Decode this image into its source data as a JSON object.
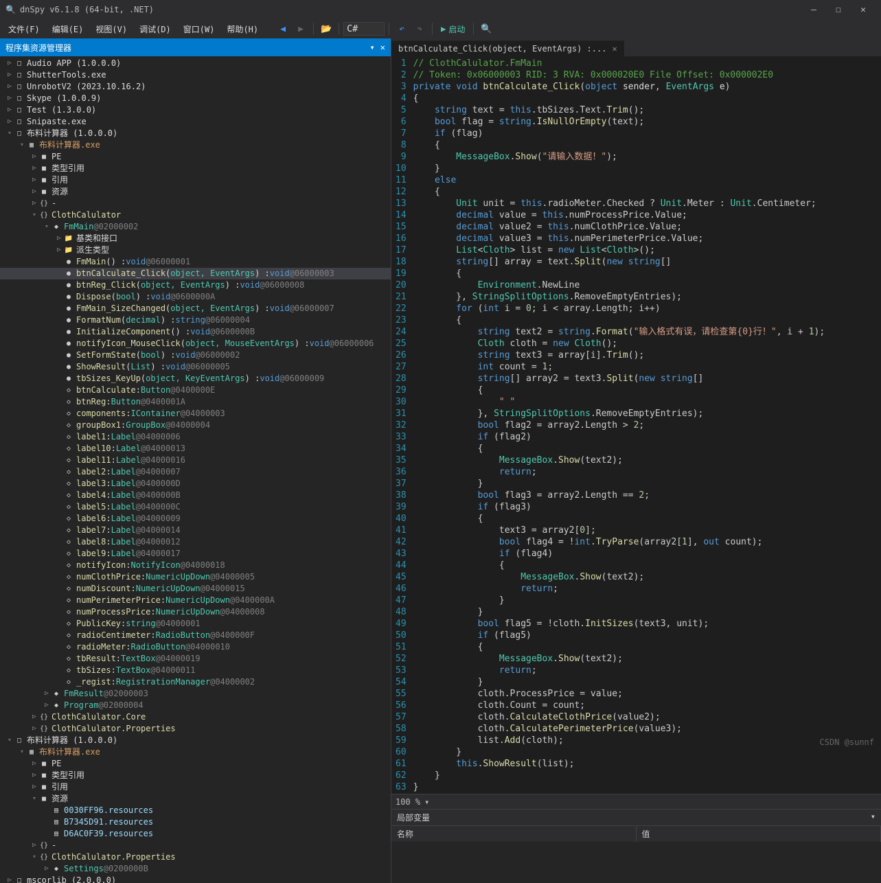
{
  "title": "dnSpy v6.1.8 (64-bit, .NET)",
  "menu": {
    "file": "文件(F)",
    "edit": "编辑(E)",
    "view": "视图(V)",
    "debug": "调试(D)",
    "window": "窗口(W)",
    "help": "帮助(H)",
    "lang": "C#",
    "start": "启动"
  },
  "panel": {
    "header": "程序集资源管理器"
  },
  "tree": [
    {
      "d": 0,
      "c": "▷",
      "i": "□",
      "t": "Audio APP (1.0.0.0)",
      "cls": "white"
    },
    {
      "d": 0,
      "c": "▷",
      "i": "□",
      "t": "ShutterTools.exe",
      "cls": "white"
    },
    {
      "d": 0,
      "c": "▷",
      "i": "□",
      "t": "UnrobotV2 (2023.10.16.2)",
      "cls": "white"
    },
    {
      "d": 0,
      "c": "▷",
      "i": "□",
      "t": "Skype (1.0.0.9)",
      "cls": "white"
    },
    {
      "d": 0,
      "c": "▷",
      "i": "□",
      "t": "Test (1.3.0.0)",
      "cls": "white"
    },
    {
      "d": 0,
      "c": "▷",
      "i": "□",
      "t": "Snipaste.exe",
      "cls": "white"
    },
    {
      "d": 0,
      "c": "▿",
      "i": "□",
      "t": "布料计算器 (1.0.0.0)",
      "cls": "white"
    },
    {
      "d": 1,
      "c": "▿",
      "i": "▦",
      "t": "布料计算器.exe",
      "cls": "oran"
    },
    {
      "d": 2,
      "c": "▷",
      "i": "■",
      "t": "PE",
      "cls": "white"
    },
    {
      "d": 2,
      "c": "▷",
      "i": "■",
      "t": "类型引用",
      "cls": "white"
    },
    {
      "d": 2,
      "c": "▷",
      "i": "■",
      "t": "引用",
      "cls": "white"
    },
    {
      "d": 2,
      "c": "▷",
      "i": "■",
      "t": "资源",
      "cls": "white"
    },
    {
      "d": 2,
      "c": "▷",
      "i": "{}",
      "t": "-",
      "cls": "white"
    },
    {
      "d": 2,
      "c": "▿",
      "i": "{}",
      "t": "ClothCalulator",
      "cls": "nm"
    },
    {
      "d": 3,
      "c": "▿",
      "i": "◆",
      "ty": "FmMain",
      "a": " @02000002"
    },
    {
      "d": 4,
      "c": "▷",
      "i": "📁",
      "t": "基类和接口",
      "cls": "white"
    },
    {
      "d": 4,
      "c": "▷",
      "i": "📁",
      "t": "派生类型",
      "cls": "white"
    },
    {
      "d": 4,
      "c": "",
      "i": "●",
      "sig": "FmMain() : void",
      "a": " @06000001"
    },
    {
      "d": 4,
      "c": "",
      "i": "●",
      "sig": "btnCalculate_Click(object, EventArgs) : void",
      "a": " @06000003",
      "sel": true
    },
    {
      "d": 4,
      "c": "",
      "i": "●",
      "sig": "btnReg_Click(object, EventArgs) : void",
      "a": " @06000008"
    },
    {
      "d": 4,
      "c": "",
      "i": "●",
      "sig": "Dispose(bool) : void",
      "a": " @0600000A"
    },
    {
      "d": 4,
      "c": "",
      "i": "●",
      "sig": "FmMain_SizeChanged(object, EventArgs) : void",
      "a": " @06000007"
    },
    {
      "d": 4,
      "c": "",
      "i": "●",
      "sig": "FormatNum(decimal) : string",
      "a": " @06000004"
    },
    {
      "d": 4,
      "c": "",
      "i": "●",
      "sig": "InitializeComponent() : void",
      "a": " @0600000B"
    },
    {
      "d": 4,
      "c": "",
      "i": "●",
      "sig": "notifyIcon_MouseClick(object, MouseEventArgs) : void",
      "a": " @06000006"
    },
    {
      "d": 4,
      "c": "",
      "i": "●",
      "sig": "SetFormState(bool) : void",
      "a": " @06000002"
    },
    {
      "d": 4,
      "c": "",
      "i": "●",
      "sig": "ShowResult(List<Cloth>) : void",
      "a": " @06000005"
    },
    {
      "d": 4,
      "c": "",
      "i": "●",
      "sig": "tbSizes_KeyUp(object, KeyEventArgs) : void",
      "a": " @06000009"
    },
    {
      "d": 4,
      "c": "",
      "i": "◇",
      "fld": "btnCalculate : Button",
      "a": " @0400000E"
    },
    {
      "d": 4,
      "c": "",
      "i": "◇",
      "fld": "btnReg : Button",
      "a": " @0400001A"
    },
    {
      "d": 4,
      "c": "",
      "i": "◇",
      "fld": "components : IContainer",
      "a": " @04000003"
    },
    {
      "d": 4,
      "c": "",
      "i": "◇",
      "fld": "groupBox1 : GroupBox",
      "a": " @04000004"
    },
    {
      "d": 4,
      "c": "",
      "i": "◇",
      "fld": "label1 : Label",
      "a": " @04000006"
    },
    {
      "d": 4,
      "c": "",
      "i": "◇",
      "fld": "label10 : Label",
      "a": " @04000013"
    },
    {
      "d": 4,
      "c": "",
      "i": "◇",
      "fld": "label11 : Label",
      "a": " @04000016"
    },
    {
      "d": 4,
      "c": "",
      "i": "◇",
      "fld": "label2 : Label",
      "a": " @04000007"
    },
    {
      "d": 4,
      "c": "",
      "i": "◇",
      "fld": "label3 : Label",
      "a": " @0400000D"
    },
    {
      "d": 4,
      "c": "",
      "i": "◇",
      "fld": "label4 : Label",
      "a": " @0400000B"
    },
    {
      "d": 4,
      "c": "",
      "i": "◇",
      "fld": "label5 : Label",
      "a": " @0400000C"
    },
    {
      "d": 4,
      "c": "",
      "i": "◇",
      "fld": "label6 : Label",
      "a": " @04000009"
    },
    {
      "d": 4,
      "c": "",
      "i": "◇",
      "fld": "label7 : Label",
      "a": " @04000014"
    },
    {
      "d": 4,
      "c": "",
      "i": "◇",
      "fld": "label8 : Label",
      "a": " @04000012"
    },
    {
      "d": 4,
      "c": "",
      "i": "◇",
      "fld": "label9 : Label",
      "a": " @04000017"
    },
    {
      "d": 4,
      "c": "",
      "i": "◇",
      "fld": "notifyIcon : NotifyIcon",
      "a": " @04000018"
    },
    {
      "d": 4,
      "c": "",
      "i": "◇",
      "fld": "numClothPrice : NumericUpDown",
      "a": " @04000005"
    },
    {
      "d": 4,
      "c": "",
      "i": "◇",
      "fld": "numDiscount : NumericUpDown",
      "a": " @04000015"
    },
    {
      "d": 4,
      "c": "",
      "i": "◇",
      "fld": "numPerimeterPrice : NumericUpDown",
      "a": " @0400000A"
    },
    {
      "d": 4,
      "c": "",
      "i": "◇",
      "fld": "numProcessPrice : NumericUpDown",
      "a": " @04000008"
    },
    {
      "d": 4,
      "c": "",
      "i": "◇",
      "fld": "PublicKey : string",
      "a": " @04000001"
    },
    {
      "d": 4,
      "c": "",
      "i": "◇",
      "fld": "radioCentimeter : RadioButton",
      "a": " @0400000F"
    },
    {
      "d": 4,
      "c": "",
      "i": "◇",
      "fld": "radioMeter : RadioButton",
      "a": " @04000010"
    },
    {
      "d": 4,
      "c": "",
      "i": "◇",
      "fld": "tbResult : TextBox",
      "a": " @04000019"
    },
    {
      "d": 4,
      "c": "",
      "i": "◇",
      "fld": "tbSizes : TextBox",
      "a": " @04000011"
    },
    {
      "d": 4,
      "c": "",
      "i": "◇",
      "fld": "_regist : RegistrationManager",
      "a": " @04000002"
    },
    {
      "d": 3,
      "c": "▷",
      "i": "◆",
      "ty": "FmResult",
      "a": " @02000003"
    },
    {
      "d": 3,
      "c": "▷",
      "i": "◆",
      "ty": "Program",
      "a": " @02000004"
    },
    {
      "d": 2,
      "c": "▷",
      "i": "{}",
      "t": "ClothCalulator.Core",
      "cls": "nm"
    },
    {
      "d": 2,
      "c": "▷",
      "i": "{}",
      "t": "ClothCalulator.Properties",
      "cls": "nm"
    },
    {
      "d": 0,
      "c": "▿",
      "i": "□",
      "t": "布料计算器 (1.0.0.0)",
      "cls": "white"
    },
    {
      "d": 1,
      "c": "▿",
      "i": "▦",
      "t": "布料计算器.exe",
      "cls": "oran"
    },
    {
      "d": 2,
      "c": "▷",
      "i": "■",
      "t": "PE",
      "cls": "white"
    },
    {
      "d": 2,
      "c": "▷",
      "i": "■",
      "t": "类型引用",
      "cls": "white"
    },
    {
      "d": 2,
      "c": "▷",
      "i": "■",
      "t": "引用",
      "cls": "white"
    },
    {
      "d": 2,
      "c": "▿",
      "i": "■",
      "t": "资源",
      "cls": "white"
    },
    {
      "d": 3,
      "c": "",
      "i": "▤",
      "t": "0030FF96.resources",
      "cls": "cyan"
    },
    {
      "d": 3,
      "c": "",
      "i": "▤",
      "t": "B7345D91.resources",
      "cls": "cyan"
    },
    {
      "d": 3,
      "c": "",
      "i": "▤",
      "t": "D6AC0F39.resources",
      "cls": "cyan"
    },
    {
      "d": 2,
      "c": "▷",
      "i": "{}",
      "t": "-",
      "cls": "white"
    },
    {
      "d": 2,
      "c": "▿",
      "i": "{}",
      "t": "ClothCalulator.Properties",
      "cls": "nm"
    },
    {
      "d": 3,
      "c": "▷",
      "i": "◆",
      "ty": "Settings",
      "a": " @0200000B"
    },
    {
      "d": 0,
      "c": "▷",
      "i": "□",
      "t": "mscorlib (2.0.0.0)",
      "cls": "white"
    }
  ],
  "tab": {
    "label": "btnCalculate_Click(object, EventArgs) :..."
  },
  "code": [
    "<span class='c'>// ClothCalulator.FmMain</span>",
    "<span class='c'>// Token: 0x06000003 RID: 3 RVA: 0x000020E0 File Offset: 0x000002E0</span>",
    "<span class='k'>private</span> <span class='k'>void</span> <span class='m'>btnCalculate_Click</span>(<span class='k'>object</span> <span class='n'>sender</span>, <span class='t'>EventArgs</span> <span class='n'>e</span>)",
    "{",
    "    <span class='k'>string</span> text = <span class='k'>this</span>.tbSizes.Text.<span class='m'>Trim</span>();",
    "    <span class='k'>bool</span> flag = <span class='k'>string</span>.<span class='m'>IsNullOrEmpty</span>(text);",
    "    <span class='k'>if</span> (flag)",
    "    {",
    "        <span class='t'>MessageBox</span>.<span class='m'>Show</span>(<span class='s'>\"请输入数据！\"</span>);",
    "    }",
    "    <span class='k'>else</span>",
    "    {",
    "        <span class='t'>Unit</span> unit = <span class='k'>this</span>.radioMeter.Checked ? <span class='t'>Unit</span>.Meter : <span class='t'>Unit</span>.Centimeter;",
    "        <span class='k'>decimal</span> value = <span class='k'>this</span>.numProcessPrice.Value;",
    "        <span class='k'>decimal</span> value2 = <span class='k'>this</span>.numClothPrice.Value;",
    "        <span class='k'>decimal</span> value3 = <span class='k'>this</span>.numPerimeterPrice.Value;",
    "        <span class='t'>List</span>&lt;<span class='t'>Cloth</span>&gt; list = <span class='k'>new</span> <span class='t'>List</span>&lt;<span class='t'>Cloth</span>&gt;();",
    "        <span class='k'>string</span>[] array = text.<span class='m'>Split</span>(<span class='k'>new</span> <span class='k'>string</span>[]",
    "        {",
    "            <span class='t'>Environment</span>.NewLine",
    "        }, <span class='t'>StringSplitOptions</span>.RemoveEmptyEntries);",
    "        <span class='k'>for</span> (<span class='k'>int</span> i = <span class='num'>0</span>; i &lt; array.Length; i++)",
    "        {",
    "            <span class='k'>string</span> text2 = <span class='k'>string</span>.<span class='m'>Format</span>(<span class='s'>\"输入格式有误，请检查第{0}行！\"</span>, i + <span class='num'>1</span>);",
    "            <span class='t'>Cloth</span> cloth = <span class='k'>new</span> <span class='t'>Cloth</span>();",
    "            <span class='k'>string</span> text3 = array[i].<span class='m'>Trim</span>();",
    "            <span class='k'>int</span> count = <span class='num'>1</span>;",
    "            <span class='k'>string</span>[] array2 = text3.<span class='m'>Split</span>(<span class='k'>new</span> <span class='k'>string</span>[]",
    "            {",
    "                <span class='s'>\" \"</span>",
    "            }, <span class='t'>StringSplitOptions</span>.RemoveEmptyEntries);",
    "            <span class='k'>bool</span> flag2 = array2.Length &gt; <span class='num'>2</span>;",
    "            <span class='k'>if</span> (flag2)",
    "            {",
    "                <span class='t'>MessageBox</span>.<span class='m'>Show</span>(text2);",
    "                <span class='k'>return</span>;",
    "            }",
    "            <span class='k'>bool</span> flag3 = array2.Length == <span class='num'>2</span>;",
    "            <span class='k'>if</span> (flag3)",
    "            {",
    "                text3 = array2[<span class='num'>0</span>];",
    "                <span class='k'>bool</span> flag4 = !<span class='k'>int</span>.<span class='m'>TryParse</span>(array2[<span class='num'>1</span>], <span class='k'>out</span> count);",
    "                <span class='k'>if</span> (flag4)",
    "                {",
    "                    <span class='t'>MessageBox</span>.<span class='m'>Show</span>(text2);",
    "                    <span class='k'>return</span>;",
    "                }",
    "            }",
    "            <span class='k'>bool</span> flag5 = !cloth.<span class='m'>InitSizes</span>(text3, unit);",
    "            <span class='k'>if</span> (flag5)",
    "            {",
    "                <span class='t'>MessageBox</span>.<span class='m'>Show</span>(text2);",
    "                <span class='k'>return</span>;",
    "            }",
    "            cloth.ProcessPrice = value;",
    "            cloth.Count = count;",
    "            cloth.<span class='m'>CalculateClothPrice</span>(value2);",
    "            cloth.<span class='m'>CalculatePerimeterPrice</span>(value3);",
    "            list.<span class='m'>Add</span>(cloth);",
    "        }",
    "        <span class='k'>this</span>.<span class='m'>ShowResult</span>(list);",
    "    }",
    "}",
    ""
  ],
  "zoom": "100 %",
  "locals": {
    "title": "局部变量",
    "name": "名称",
    "value": "值"
  },
  "watermark": "CSDN @sunnf"
}
